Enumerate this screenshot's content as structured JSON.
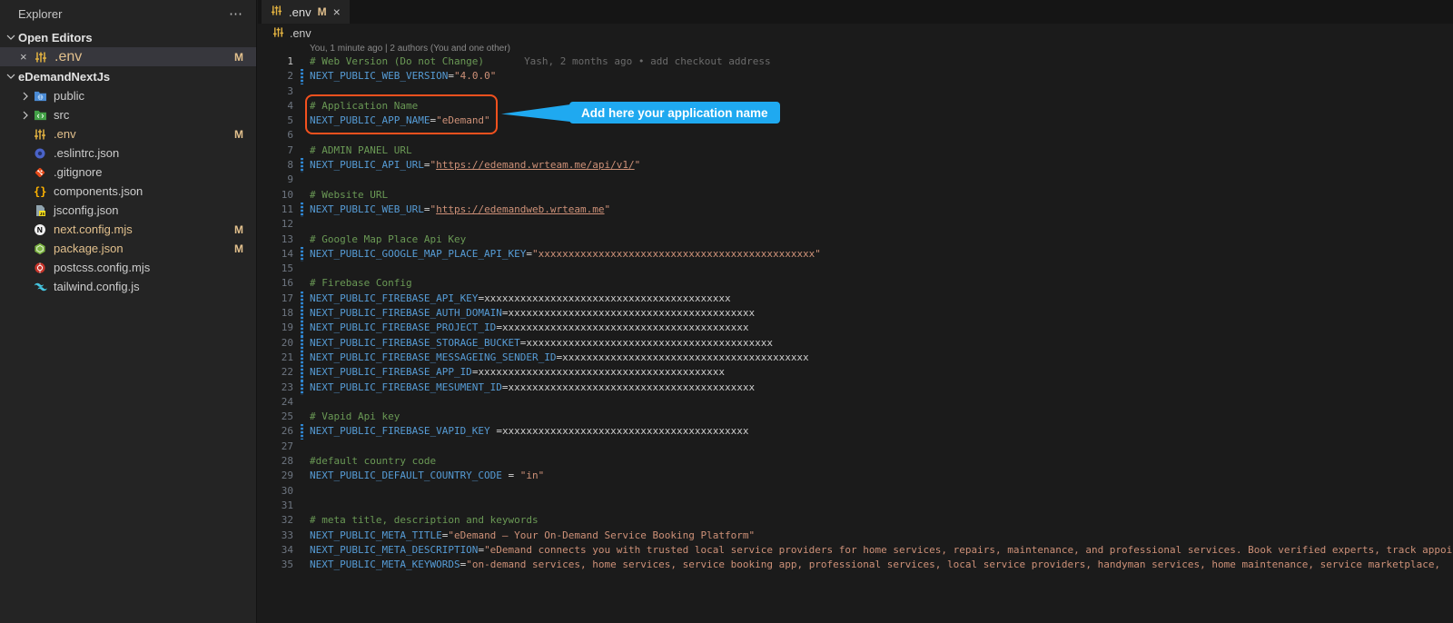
{
  "sidebar": {
    "title": "Explorer",
    "more_icon": "⋯",
    "open_editors": {
      "label": "Open Editors",
      "items": [
        {
          "label": ".env",
          "badge": "M",
          "icon": "env-sliders-icon",
          "close_icon": "×"
        }
      ]
    },
    "project": {
      "label": "eDemandNextJs",
      "items": [
        {
          "label": "public",
          "icon": "folder-public-icon",
          "badge": ""
        },
        {
          "label": "src",
          "icon": "folder-src-icon",
          "badge": ""
        },
        {
          "label": ".env",
          "icon": "env-sliders-icon",
          "badge": "M"
        },
        {
          "label": ".eslintrc.json",
          "icon": "eslint-icon",
          "badge": ""
        },
        {
          "label": ".gitignore",
          "icon": "git-icon",
          "badge": ""
        },
        {
          "label": "components.json",
          "icon": "braces-icon",
          "badge": ""
        },
        {
          "label": "jsconfig.json",
          "icon": "jsconfig-icon",
          "badge": ""
        },
        {
          "label": "next.config.mjs",
          "icon": "nextjs-icon",
          "badge": "M"
        },
        {
          "label": "package.json",
          "icon": "package-icon",
          "badge": "M"
        },
        {
          "label": "postcss.config.mjs",
          "icon": "postcss-icon",
          "badge": ""
        },
        {
          "label": "tailwind.config.js",
          "icon": "tailwind-icon",
          "badge": ""
        }
      ]
    }
  },
  "editor": {
    "tab": {
      "label": ".env",
      "badge": "M",
      "close_icon": "×"
    },
    "breadcrumb": ".env",
    "title_action_icons": [
      "source-control-graph-icon",
      "open-changes-icon",
      "compare-revision-icon",
      "partial-icon"
    ],
    "codelens": "You, 1 minute ago | 2 authors (You and one other)",
    "modified_lines": [
      2,
      8,
      11,
      14,
      17,
      18,
      19,
      20,
      21,
      22,
      23,
      26
    ],
    "lines": [
      [
        [
          "cm",
          "# Web Version (Do not Change)"
        ],
        [
          "b",
          "Yash, 2 months ago • add checkout address"
        ]
      ],
      [
        [
          "v",
          "NEXT_PUBLIC_WEB_VERSION"
        ],
        [
          "o",
          "="
        ],
        [
          "s",
          "\"4.0.0\""
        ]
      ],
      [],
      [
        [
          "cm",
          "# Application Name"
        ]
      ],
      [
        [
          "v",
          "NEXT_PUBLIC_APP_NAME"
        ],
        [
          "o",
          "="
        ],
        [
          "s",
          "\"eDemand\""
        ]
      ],
      [],
      [
        [
          "cm",
          "# ADMIN PANEL URL"
        ]
      ],
      [
        [
          "v",
          "NEXT_PUBLIC_API_URL"
        ],
        [
          "o",
          "="
        ],
        [
          "s",
          "\""
        ],
        [
          "u",
          "https://edemand.wrteam.me/api/v1/"
        ],
        [
          "s",
          "\""
        ]
      ],
      [],
      [
        [
          "cm",
          "# Website URL"
        ]
      ],
      [
        [
          "v",
          "NEXT_PUBLIC_WEB_URL"
        ],
        [
          "o",
          "="
        ],
        [
          "s",
          "\""
        ],
        [
          "u",
          "https://edemandweb.wrteam.me"
        ],
        [
          "s",
          "\""
        ]
      ],
      [],
      [
        [
          "cm",
          "# Google Map Place Api Key"
        ]
      ],
      [
        [
          "v",
          "NEXT_PUBLIC_GOOGLE_MAP_PLACE_API_KEY"
        ],
        [
          "o",
          "="
        ],
        [
          "s",
          "\"xxxxxxxxxxxxxxxxxxxxxxxxxxxxxxxxxxxxxxxxxxxxxx\""
        ]
      ],
      [],
      [
        [
          "cm",
          "# Firebase Config"
        ]
      ],
      [
        [
          "v",
          "NEXT_PUBLIC_FIREBASE_API_KEY"
        ],
        [
          "o",
          "="
        ],
        [
          "p",
          "xxxxxxxxxxxxxxxxxxxxxxxxxxxxxxxxxxxxxxxxx"
        ]
      ],
      [
        [
          "v",
          "NEXT_PUBLIC_FIREBASE_AUTH_DOMAIN"
        ],
        [
          "o",
          "="
        ],
        [
          "p",
          "xxxxxxxxxxxxxxxxxxxxxxxxxxxxxxxxxxxxxxxxx"
        ]
      ],
      [
        [
          "v",
          "NEXT_PUBLIC_FIREBASE_PROJECT_ID"
        ],
        [
          "o",
          "="
        ],
        [
          "p",
          "xxxxxxxxxxxxxxxxxxxxxxxxxxxxxxxxxxxxxxxxx"
        ]
      ],
      [
        [
          "v",
          "NEXT_PUBLIC_FIREBASE_STORAGE_BUCKET"
        ],
        [
          "o",
          "="
        ],
        [
          "p",
          "xxxxxxxxxxxxxxxxxxxxxxxxxxxxxxxxxxxxxxxxx"
        ]
      ],
      [
        [
          "v",
          "NEXT_PUBLIC_FIREBASE_MESSAGEING_SENDER_ID"
        ],
        [
          "o",
          "="
        ],
        [
          "p",
          "xxxxxxxxxxxxxxxxxxxxxxxxxxxxxxxxxxxxxxxxx"
        ]
      ],
      [
        [
          "v",
          "NEXT_PUBLIC_FIREBASE_APP_ID"
        ],
        [
          "o",
          "="
        ],
        [
          "p",
          "xxxxxxxxxxxxxxxxxxxxxxxxxxxxxxxxxxxxxxxxx"
        ]
      ],
      [
        [
          "v",
          "NEXT_PUBLIC_FIREBASE_MESUMENT_ID"
        ],
        [
          "o",
          "="
        ],
        [
          "p",
          "xxxxxxxxxxxxxxxxxxxxxxxxxxxxxxxxxxxxxxxxx"
        ]
      ],
      [],
      [
        [
          "cm",
          "# Vapid Api key"
        ]
      ],
      [
        [
          "v",
          "NEXT_PUBLIC_FIREBASE_VAPID_KEY "
        ],
        [
          "o",
          "="
        ],
        [
          "p",
          "xxxxxxxxxxxxxxxxxxxxxxxxxxxxxxxxxxxxxxxxx"
        ]
      ],
      [],
      [
        [
          "cm",
          "#default country code"
        ]
      ],
      [
        [
          "v",
          "NEXT_PUBLIC_DEFAULT_COUNTRY_CODE"
        ],
        [
          "o",
          " = "
        ],
        [
          "s",
          "\"in\""
        ]
      ],
      [],
      [],
      [
        [
          "cm",
          "# meta title, description and keywords"
        ]
      ],
      [
        [
          "v",
          "NEXT_PUBLIC_META_TITLE"
        ],
        [
          "o",
          "="
        ],
        [
          "s",
          "\"eDemand – Your On-Demand Service Booking Platform\""
        ]
      ],
      [
        [
          "v",
          "NEXT_PUBLIC_META_DESCRIPTION"
        ],
        [
          "o",
          "="
        ],
        [
          "s",
          "\"eDemand connects you with trusted local service providers for home services, repairs, maintenance, and professional services. Book verified experts, track appoi"
        ]
      ],
      [
        [
          "v",
          "NEXT_PUBLIC_META_KEYWORDS"
        ],
        [
          "o",
          "="
        ],
        [
          "s",
          "\"on-demand services, home services, service booking app, professional services, local service providers, handyman services, home maintenance, service marketplace, "
        ]
      ]
    ]
  },
  "annotations": {
    "callout_text": "Add here your application name",
    "highlight_color": "#f4511e",
    "callout_color": "#1fa9f0"
  }
}
